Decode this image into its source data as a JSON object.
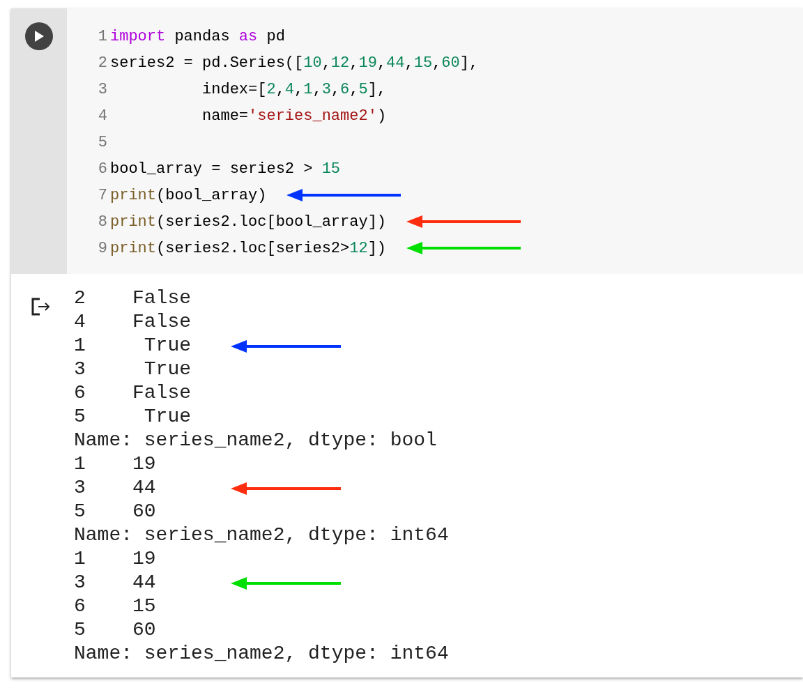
{
  "code_cell": {
    "lines": [
      {
        "number": "1",
        "tokens": [
          {
            "kind": "keyword",
            "text": "import"
          },
          {
            "kind": "plain",
            "text": " pandas "
          },
          {
            "kind": "keyword",
            "text": "as"
          },
          {
            "kind": "plain",
            "text": " pd"
          }
        ]
      },
      {
        "number": "2",
        "tokens": [
          {
            "kind": "plain",
            "text": "series2 = pd.Series(["
          },
          {
            "kind": "number",
            "text": "10"
          },
          {
            "kind": "plain",
            "text": ","
          },
          {
            "kind": "number",
            "text": "12"
          },
          {
            "kind": "plain",
            "text": ","
          },
          {
            "kind": "number",
            "text": "19"
          },
          {
            "kind": "plain",
            "text": ","
          },
          {
            "kind": "number",
            "text": "44"
          },
          {
            "kind": "plain",
            "text": ","
          },
          {
            "kind": "number",
            "text": "15"
          },
          {
            "kind": "plain",
            "text": ","
          },
          {
            "kind": "number",
            "text": "60"
          },
          {
            "kind": "plain",
            "text": "],"
          }
        ]
      },
      {
        "number": "3",
        "tokens": [
          {
            "kind": "plain",
            "text": "          index=["
          },
          {
            "kind": "number",
            "text": "2"
          },
          {
            "kind": "plain",
            "text": ","
          },
          {
            "kind": "number",
            "text": "4"
          },
          {
            "kind": "plain",
            "text": ","
          },
          {
            "kind": "number",
            "text": "1"
          },
          {
            "kind": "plain",
            "text": ","
          },
          {
            "kind": "number",
            "text": "3"
          },
          {
            "kind": "plain",
            "text": ","
          },
          {
            "kind": "number",
            "text": "6"
          },
          {
            "kind": "plain",
            "text": ","
          },
          {
            "kind": "number",
            "text": "5"
          },
          {
            "kind": "plain",
            "text": "],"
          }
        ]
      },
      {
        "number": "4",
        "tokens": [
          {
            "kind": "plain",
            "text": "          name="
          },
          {
            "kind": "string",
            "text": "'series_name2'"
          },
          {
            "kind": "plain",
            "text": ")"
          }
        ]
      },
      {
        "number": "5"
      },
      {
        "number": "6",
        "tokens": [
          {
            "kind": "plain",
            "text": "bool_array = series2 > "
          },
          {
            "kind": "number",
            "text": "15"
          }
        ]
      },
      {
        "number": "7",
        "tokens": [
          {
            "kind": "builtin",
            "text": "print"
          },
          {
            "kind": "plain",
            "text": "(bool_array)"
          }
        ],
        "arrow": {
          "color": "#0033ff"
        }
      },
      {
        "number": "8",
        "tokens": [
          {
            "kind": "builtin",
            "text": "print"
          },
          {
            "kind": "plain",
            "text": "(series2.loc[bool_array])"
          }
        ],
        "arrow": {
          "color": "#ff2d0f"
        }
      },
      {
        "number": "9",
        "tokens": [
          {
            "kind": "builtin",
            "text": "print"
          },
          {
            "kind": "plain",
            "text": "(series2.loc[series2>"
          },
          {
            "kind": "number",
            "text": "12"
          },
          {
            "kind": "plain",
            "text": "])"
          }
        ],
        "arrow": {
          "color": "#00e000"
        }
      }
    ]
  },
  "output": {
    "lines": [
      {
        "text": "2    False"
      },
      {
        "text": "4    False"
      },
      {
        "text": "1     True",
        "arrow": {
          "color": "#0033ff"
        }
      },
      {
        "text": "3     True"
      },
      {
        "text": "6    False"
      },
      {
        "text": "5     True"
      },
      {
        "text": "Name: series_name2, dtype: bool"
      },
      {
        "text": "1    19"
      },
      {
        "text": "3    44",
        "arrow": {
          "color": "#ff2d0f"
        }
      },
      {
        "text": "5    60"
      },
      {
        "text": "Name: series_name2, dtype: int64"
      },
      {
        "text": "1    19"
      },
      {
        "text": "3    44",
        "arrow": {
          "color": "#00e000"
        }
      },
      {
        "text": "6    15"
      },
      {
        "text": "5    60"
      },
      {
        "text": "Name: series_name2, dtype: int64"
      }
    ]
  }
}
